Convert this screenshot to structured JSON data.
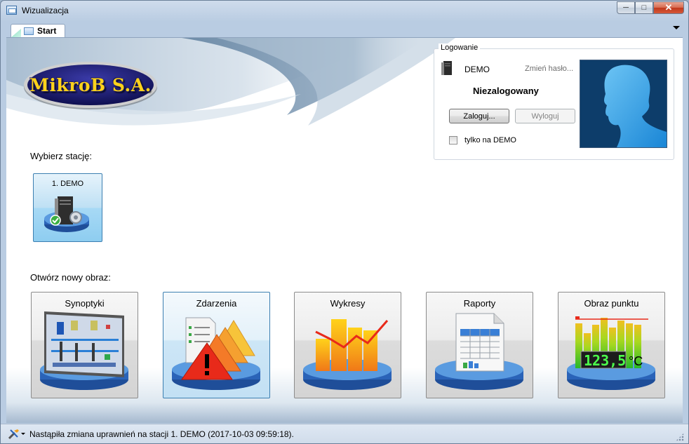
{
  "window": {
    "title": "Wizualizacja",
    "controls": {
      "minimize": "─",
      "maximize": "□",
      "close": "✕"
    }
  },
  "tabs": [
    {
      "label": "Start",
      "active": true
    }
  ],
  "logo": {
    "text": "MikroB S.A."
  },
  "login": {
    "legend": "Logowanie",
    "station": "DEMO",
    "change_password": "Zmień hasło...",
    "status": "Niezalogowany",
    "login_button": "Zaloguj...",
    "logout_button": "Wyloguj",
    "demo_only_label": "tylko na DEMO",
    "demo_only_checked": false
  },
  "stations": {
    "heading": "Wybierz stację:",
    "items": [
      {
        "label": "1. DEMO",
        "icon": "server-ok-icon"
      }
    ]
  },
  "views": {
    "heading": "Otwórz nowy obraz:",
    "items": [
      {
        "label": "Synoptyki",
        "icon": "synoptic-icon"
      },
      {
        "label": "Zdarzenia",
        "icon": "events-warning-icon"
      },
      {
        "label": "Wykresy",
        "icon": "chart-icon"
      },
      {
        "label": "Raporty",
        "icon": "report-icon"
      },
      {
        "label": "Obraz punktu",
        "icon": "point-view-icon",
        "display_value": "123,5",
        "unit": "°C"
      }
    ]
  },
  "statusbar": {
    "message": "Nastąpiła zmiana uprawnień na stacji 1. DEMO (2017-10-03 09:59:18)."
  },
  "colors": {
    "accent": "#3c7fb1",
    "platform": "#2a63b8",
    "logo_gold": "#ffd21a",
    "logo_navy": "#1a1a60"
  }
}
